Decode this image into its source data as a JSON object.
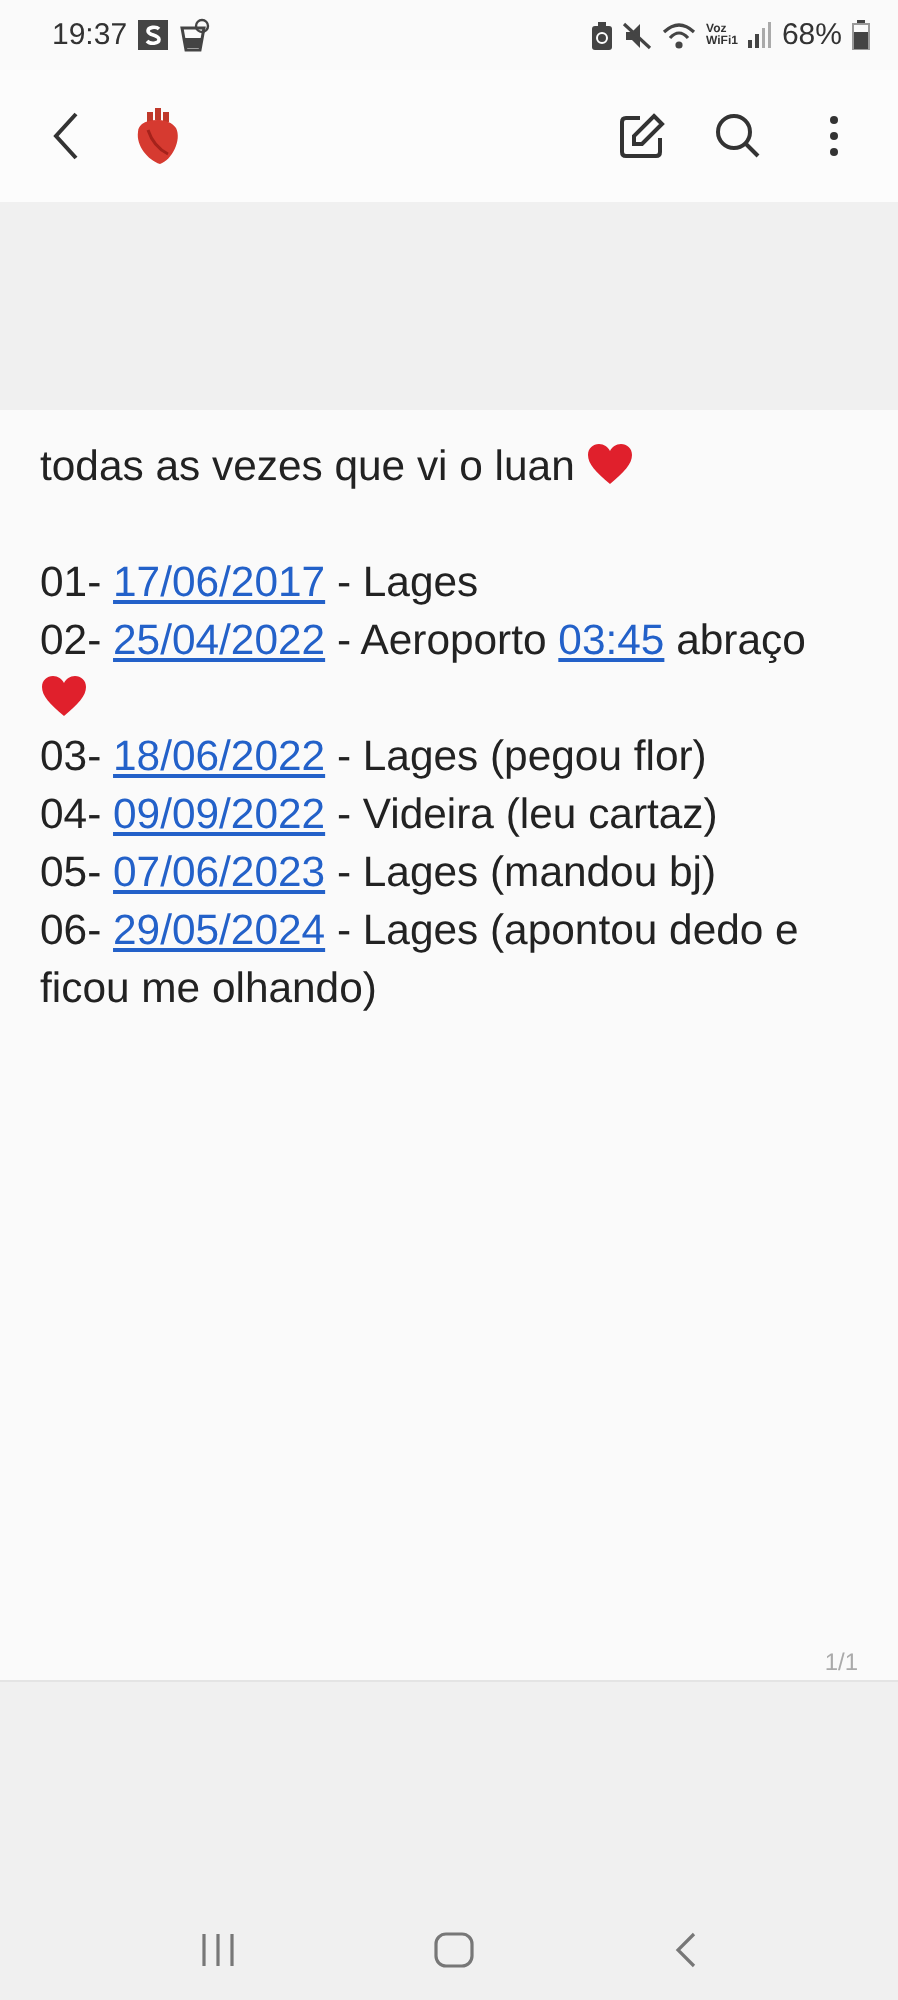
{
  "status_bar": {
    "time": "19:37",
    "wifi_calling": [
      "Voz",
      "WiFi1"
    ],
    "battery": "68%"
  },
  "note_lines": [
    [
      {
        "kind": "text",
        "text": "todas as vezes que vi o luan "
      },
      {
        "kind": "heart"
      }
    ],
    [
      {
        "kind": "blank"
      }
    ],
    [
      {
        "kind": "text",
        "text": "01- "
      },
      {
        "kind": "link",
        "text": "17/06/2017"
      },
      {
        "kind": "text",
        "text": " - Lages"
      }
    ],
    [
      {
        "kind": "text",
        "text": "02- "
      },
      {
        "kind": "link",
        "text": "25/04/2022"
      },
      {
        "kind": "text",
        "text": " - Aeroporto "
      },
      {
        "kind": "link",
        "text": "03:45"
      },
      {
        "kind": "text",
        "text": " abraço "
      },
      {
        "kind": "heart"
      }
    ],
    [
      {
        "kind": "text",
        "text": "03- "
      },
      {
        "kind": "link",
        "text": "18/06/2022"
      },
      {
        "kind": "text",
        "text": " - Lages (pegou flor)"
      }
    ],
    [
      {
        "kind": "text",
        "text": "04- "
      },
      {
        "kind": "link",
        "text": "09/09/2022"
      },
      {
        "kind": "text",
        "text": " - Videira (leu cartaz)"
      }
    ],
    [
      {
        "kind": "text",
        "text": "05- "
      },
      {
        "kind": "link",
        "text": "07/06/2023"
      },
      {
        "kind": "text",
        "text": " - Lages (mandou bj)"
      }
    ],
    [
      {
        "kind": "text",
        "text": "06- "
      },
      {
        "kind": "link",
        "text": "29/05/2024"
      },
      {
        "kind": "text",
        "text": " - Lages (apontou dedo e ficou me olhando)"
      }
    ]
  ],
  "page_counter": "1/1"
}
